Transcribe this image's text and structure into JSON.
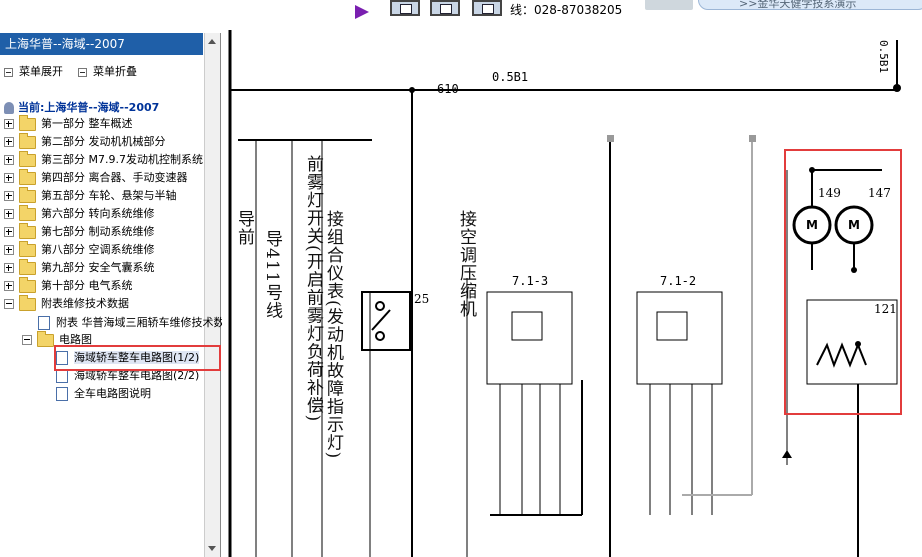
{
  "toolbar": {
    "phone_text": "线：028-87038205",
    "promo_text": ">>金华天健学技系演示"
  },
  "sidebar": {
    "title": "上海华普--海域--2007",
    "expand_label": "菜单展开",
    "collapse_label": "菜单折叠",
    "current_label": "当前:上海华普--海域--2007",
    "items": [
      {
        "label": "第一部分 整车概述"
      },
      {
        "label": "第二部分 发动机机械部分"
      },
      {
        "label": "第三部分 M7.9.7发动机控制系统"
      },
      {
        "label": "第四部分 离合器、手动变速器"
      },
      {
        "label": "第五部分 车轮、悬架与半轴"
      },
      {
        "label": "第六部分 转向系统维修"
      },
      {
        "label": "第七部分 制动系统维修"
      },
      {
        "label": "第八部分 空调系统维修"
      },
      {
        "label": "第九部分 安全气囊系统"
      },
      {
        "label": "第十部分 电气系统"
      },
      {
        "label": "附表维修技术数据"
      }
    ],
    "appendix_doc": "附表 华普海域三厢轿车维修技术数据",
    "circuit_folder": "电路图",
    "circuit_docs": [
      {
        "label": "海域轿车整车电路图(1/2)"
      },
      {
        "label": "海域轿车整车电路图(2/2)"
      },
      {
        "label": "全车电路图说明"
      }
    ]
  },
  "diagram": {
    "wire_610": "610",
    "wire_0_5b1": "0.5B1",
    "wire_top_right": "0.5B1",
    "label_col1": "导前",
    "label_col2": "导411号线",
    "label_col3": "前雾灯开关(开启前雾灯负荷补偿)",
    "label_col4": "接组合仪表(发动机故障指示灯)",
    "label_col5": "接空调压缩机",
    "relay_1": "7.1-3",
    "relay_2": "7.1-2",
    "motor_1": "149",
    "motor_2": "147",
    "heater": "121",
    "switch_num": "25",
    "motor_glyph": "M"
  }
}
